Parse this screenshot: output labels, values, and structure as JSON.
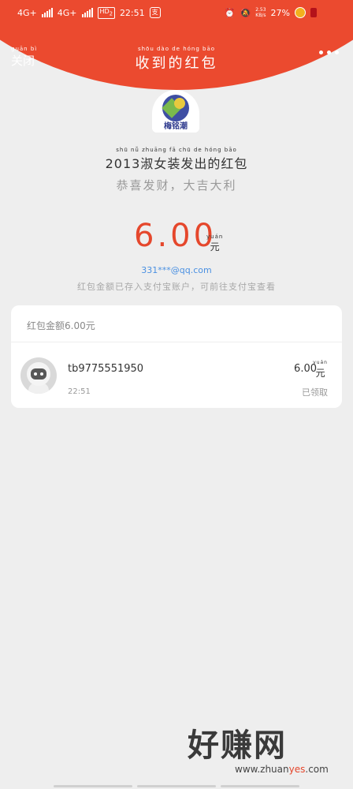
{
  "status_bar": {
    "network1": "4G+",
    "network2": "4G+",
    "hd": "HD",
    "hd_sub": "2",
    "time": "22:51",
    "speed_top": "2.53",
    "speed_bottom": "KB/s",
    "battery": "27%"
  },
  "header": {
    "close_pinyin": "guān  bì",
    "close_label": "关闭",
    "title_pinyin": "shōu dào de hóng bāo",
    "title": "收到的红包"
  },
  "sender": {
    "avatar_text": "梅铭潮",
    "pinyin": "shū nǚ zhuāng fā chū de hóng bāo",
    "name": "2013淑女装发出的红包",
    "wish": "恭喜发财，大吉大利"
  },
  "amount": {
    "value": "6.00",
    "unit_pinyin": "yuán",
    "unit": "元",
    "email": "331***@qq.com",
    "notice": "红包金额已存入支付宝账户，可前往支付宝查看"
  },
  "card": {
    "header": "红包金额6.00元",
    "rows": [
      {
        "name": "tb9775551950",
        "time": "22:51",
        "amount": "6.00",
        "unit_pinyin": "yuán",
        "unit": "元",
        "status": "已领取"
      }
    ]
  },
  "watermark": {
    "brand": "好赚网",
    "url_a": "www.zhuan",
    "url_b": "yes",
    "url_c": ".com"
  },
  "colors": {
    "accent": "#eb4a2f",
    "amount": "#e5472c",
    "link": "#4a90e2"
  }
}
